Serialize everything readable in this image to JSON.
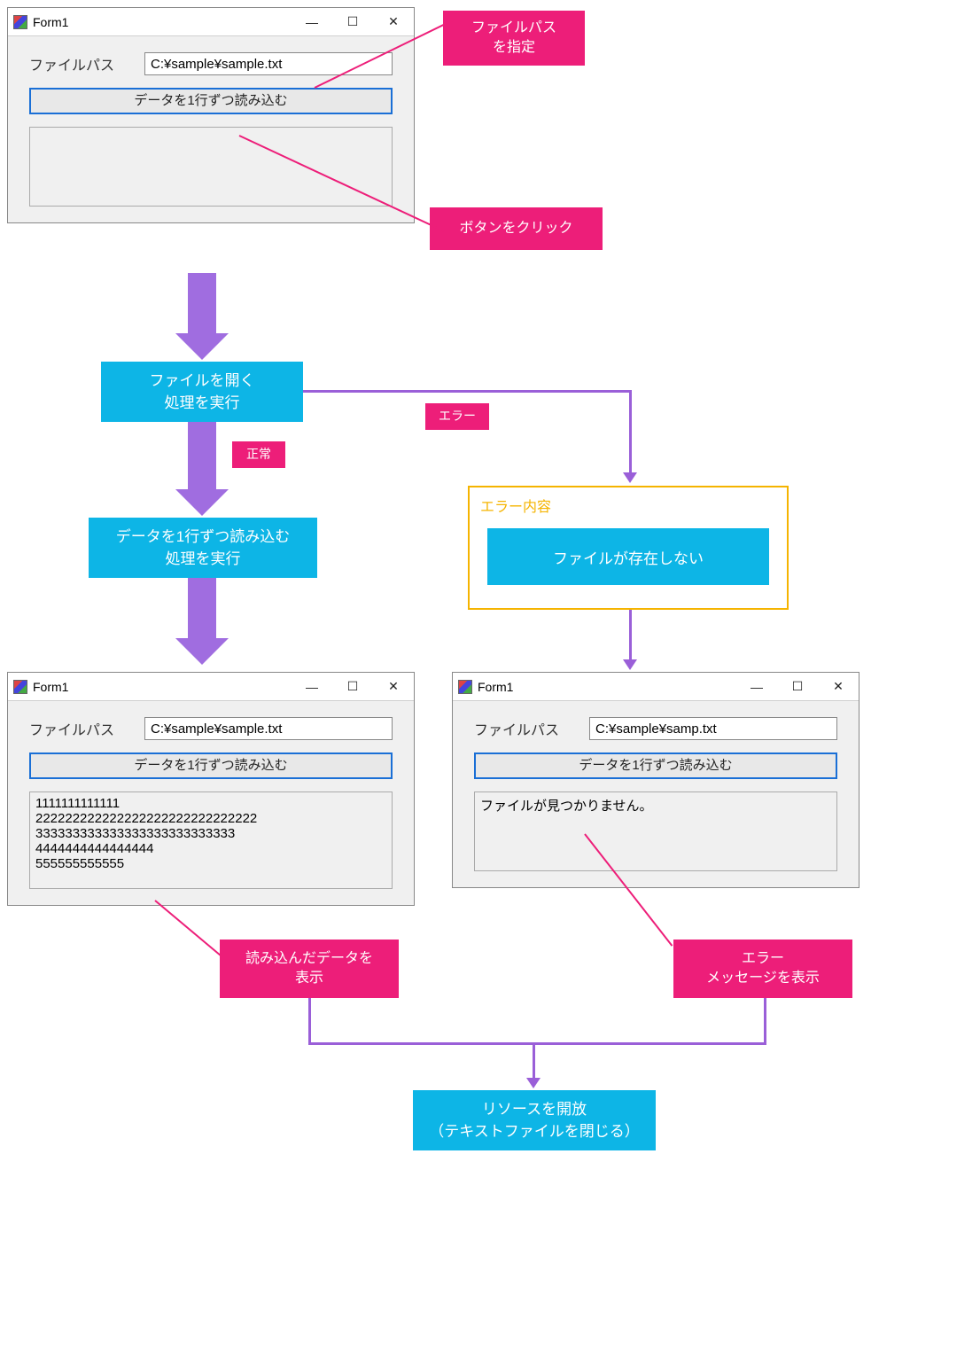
{
  "colors": {
    "flow": "#0db5e6",
    "callout": "#ed1e79",
    "connector": "#9a5fd8",
    "errorBorder": "#f5b400"
  },
  "callouts": {
    "filepath": "ファイルパス\nを指定",
    "click": "ボタンをクリック",
    "normal": "正常",
    "error": "エラー",
    "showData": "読み込んだデータを\n表示",
    "showError": "エラー\nメッセージを表示"
  },
  "flow": {
    "open": "ファイルを開く\n処理を実行",
    "read": "データを1行ずつ読み込む\n処理を実行",
    "release": "リソースを開放\n（テキストファイルを閉じる）"
  },
  "errorPanel": {
    "title": "エラー内容",
    "item": "ファイルが存在しない"
  },
  "forms": {
    "title": "Form1",
    "label": "ファイルパス",
    "button": "データを1行ずつ読み込む",
    "top": {
      "path": "C:¥sample¥sample.txt",
      "output": ""
    },
    "left": {
      "path": "C:¥sample¥sample.txt",
      "output": "1111111111111\n222222222222222222222222222222\n333333333333333333333333333\n4444444444444444\n555555555555"
    },
    "right": {
      "path": "C:¥sample¥samp.txt",
      "output": "ファイルが見つかりません。"
    }
  }
}
